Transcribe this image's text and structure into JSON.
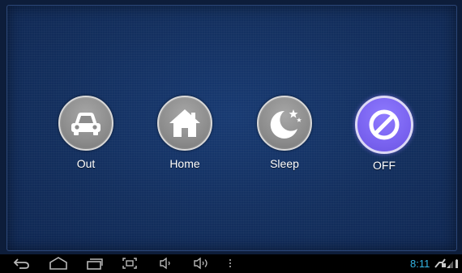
{
  "modes": [
    {
      "id": "out",
      "label": "Out",
      "icon": "car-icon"
    },
    {
      "id": "home",
      "label": "Home",
      "icon": "house-icon"
    },
    {
      "id": "sleep",
      "label": "Sleep",
      "icon": "moon-stars-icon"
    },
    {
      "id": "off",
      "label": "OFF",
      "icon": "prohibited-icon",
      "selected": true
    }
  ],
  "navbar": {
    "buttons": [
      "back-icon",
      "home-icon",
      "recent-apps-icon",
      "screenshot-icon",
      "volume-down-icon",
      "volume-up-icon",
      "menu-dots-icon"
    ]
  },
  "status": {
    "time": "8:11",
    "icons": [
      "usb-debug-icon",
      "signal-icon",
      "battery-icon"
    ]
  },
  "colors": {
    "panel_background": "#153466",
    "mode_button": "#8c8c8c",
    "selected_mode": "#7a63f0",
    "clock": "#33b5e5"
  }
}
